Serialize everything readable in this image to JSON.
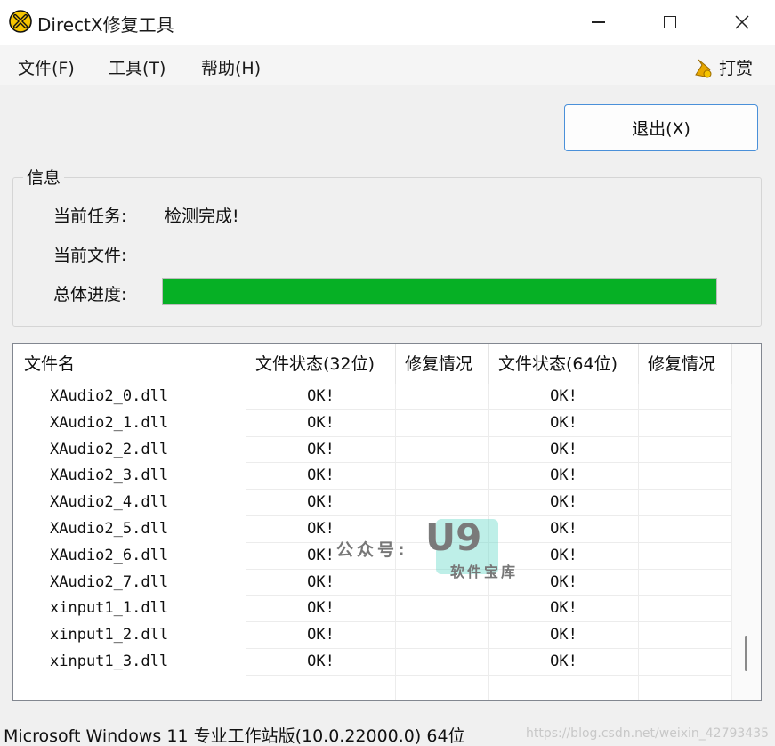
{
  "window": {
    "title": "DirectX修复工具"
  },
  "menu": {
    "items": [
      {
        "label": "文件(F)"
      },
      {
        "label": "工具(T)"
      },
      {
        "label": "帮助(H)"
      }
    ],
    "donate_label": "打赏"
  },
  "exit_button": {
    "label": "退出(X)"
  },
  "info": {
    "legend": "信息",
    "task_label": "当前任务:",
    "task_value": "检测完成!",
    "file_label": "当前文件:",
    "file_value": "",
    "progress_label": "总体进度:",
    "progress_percent": 100
  },
  "table": {
    "headers": [
      "文件名",
      "文件状态(32位)",
      "修复情况",
      "文件状态(64位)",
      "修复情况"
    ],
    "rows": [
      {
        "name": "XAudio2_0.dll",
        "s32": "OK!",
        "f32": "",
        "s64": "OK!",
        "f64": ""
      },
      {
        "name": "XAudio2_1.dll",
        "s32": "OK!",
        "f32": "",
        "s64": "OK!",
        "f64": ""
      },
      {
        "name": "XAudio2_2.dll",
        "s32": "OK!",
        "f32": "",
        "s64": "OK!",
        "f64": ""
      },
      {
        "name": "XAudio2_3.dll",
        "s32": "OK!",
        "f32": "",
        "s64": "OK!",
        "f64": ""
      },
      {
        "name": "XAudio2_4.dll",
        "s32": "OK!",
        "f32": "",
        "s64": "OK!",
        "f64": ""
      },
      {
        "name": "XAudio2_5.dll",
        "s32": "OK!",
        "f32": "",
        "s64": "OK!",
        "f64": ""
      },
      {
        "name": "XAudio2_6.dll",
        "s32": "OK!",
        "f32": "",
        "s64": "OK!",
        "f64": ""
      },
      {
        "name": "XAudio2_7.dll",
        "s32": "OK!",
        "f32": "",
        "s64": "OK!",
        "f64": ""
      },
      {
        "name": "xinput1_1.dll",
        "s32": "OK!",
        "f32": "",
        "s64": "OK!",
        "f64": ""
      },
      {
        "name": "xinput1_2.dll",
        "s32": "OK!",
        "f32": "",
        "s64": "OK!",
        "f64": ""
      },
      {
        "name": "xinput1_3.dll",
        "s32": "OK!",
        "f32": "",
        "s64": "OK!",
        "f64": ""
      },
      {
        "name": "",
        "s32": "",
        "f32": "",
        "s64": "",
        "f64": ""
      }
    ]
  },
  "watermark": {
    "label": "公众号:",
    "logo": "U9",
    "sub": "软件宝库"
  },
  "status": {
    "text": "Microsoft Windows 11 专业工作站版(10.0.22000.0) 64位"
  },
  "url_watermark": "https://blog.csdn.net/weixin_42793435",
  "colors": {
    "progress": "#06b025",
    "accent": "#4a90d9",
    "icon_yellow": "#f5c400"
  }
}
